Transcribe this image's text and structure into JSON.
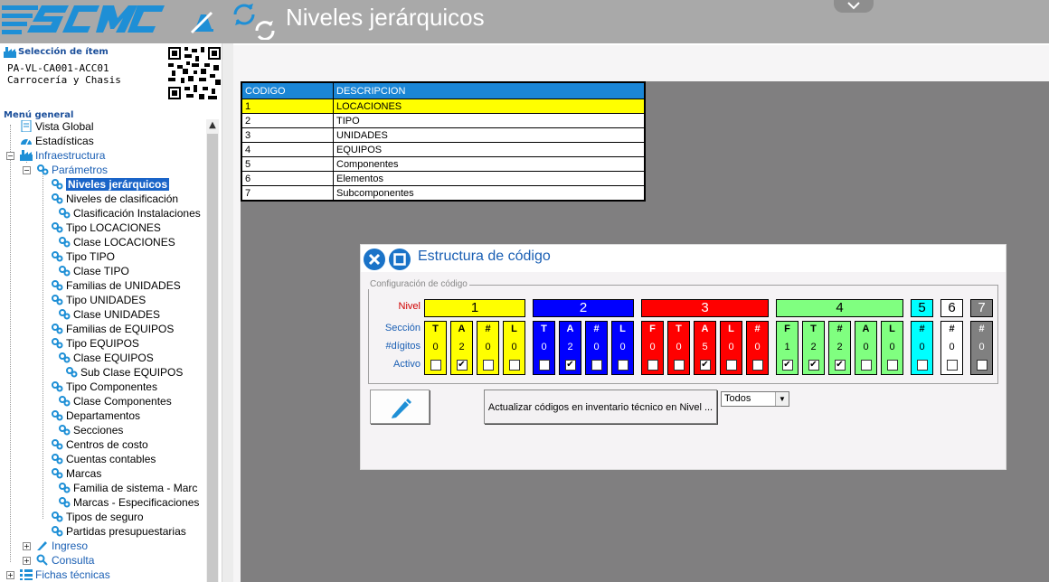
{
  "header": {
    "title": "Niveles jerárquicos"
  },
  "selection": {
    "label": "Selección de ítem",
    "code": "PA-VL-CA001-ACC01",
    "name": "Carrocería y Chasis"
  },
  "menu": {
    "label": "Menú general",
    "items": [
      {
        "label": "Vista Global"
      },
      {
        "label": "Estadísticas"
      },
      {
        "label": "Infraestructura"
      },
      {
        "label": "Parámetros"
      },
      {
        "label": "Niveles jerárquicos"
      },
      {
        "label": "Niveles de clasificación"
      },
      {
        "label": "Clasificación Instalaciones"
      },
      {
        "label": "Tipo LOCACIONES"
      },
      {
        "label": "Clase LOCACIONES"
      },
      {
        "label": "Tipo TIPO"
      },
      {
        "label": "Clase TIPO"
      },
      {
        "label": "Familias de UNIDADES"
      },
      {
        "label": "Tipo UNIDADES"
      },
      {
        "label": "Clase UNIDADES"
      },
      {
        "label": "Familias de EQUIPOS"
      },
      {
        "label": "Tipo EQUIPOS"
      },
      {
        "label": "Clase EQUIPOS"
      },
      {
        "label": "Sub Clase EQUIPOS"
      },
      {
        "label": "Tipo Componentes"
      },
      {
        "label": "Clase Componentes"
      },
      {
        "label": "Departamentos"
      },
      {
        "label": "Secciones"
      },
      {
        "label": "Centros de costo"
      },
      {
        "label": "Cuentas contables"
      },
      {
        "label": "Marcas"
      },
      {
        "label": "Familia de sistema - Marc"
      },
      {
        "label": "Marcas - Especificaciones"
      },
      {
        "label": "Tipos de seguro"
      },
      {
        "label": "Partidas presupuestarias"
      },
      {
        "label": "Ingreso"
      },
      {
        "label": "Consulta"
      },
      {
        "label": "Fichas técnicas"
      }
    ]
  },
  "grid": {
    "headers": [
      "CODIGO",
      "DESCRIPCION"
    ],
    "rows": [
      [
        "1",
        "LOCACIONES"
      ],
      [
        "2",
        "TIPO"
      ],
      [
        "3",
        "UNIDADES"
      ],
      [
        "4",
        "EQUIPOS"
      ],
      [
        "5",
        "Componentes"
      ],
      [
        "6",
        "Elementos"
      ],
      [
        "7",
        "Subcomponentes"
      ]
    ]
  },
  "dialog": {
    "title": "Estructura de código",
    "legend": "Configuración de código",
    "row_labels": {
      "nivel": "Nivel",
      "seccion": "Sección",
      "digitos": "#dígitos",
      "activo": "Activo"
    },
    "levels": [
      {
        "label": "1",
        "color": "#ffff00",
        "text_color": "#000000"
      },
      {
        "label": "2",
        "color": "#0000ff",
        "text_color": "#ffffff"
      },
      {
        "label": "3",
        "color": "#ff0000",
        "text_color": "#ffffff"
      },
      {
        "label": "4",
        "color": "#80ff80",
        "text_color": "#000000"
      },
      {
        "label": "5",
        "color": "#00ffff",
        "text_color": "#000000"
      },
      {
        "label": "6",
        "color": "#ffffff",
        "text_color": "#000000"
      },
      {
        "label": "7",
        "color": "#808080",
        "text_color": "#ffffff"
      }
    ],
    "sections": [
      {
        "level": 1,
        "section": "T",
        "digits": "0",
        "active": false
      },
      {
        "level": 1,
        "section": "A",
        "digits": "2",
        "active": true
      },
      {
        "level": 1,
        "section": "#",
        "digits": "0",
        "active": false
      },
      {
        "level": 1,
        "section": "L",
        "digits": "0",
        "active": false
      },
      {
        "level": 2,
        "section": "T",
        "digits": "0",
        "active": false
      },
      {
        "level": 2,
        "section": "A",
        "digits": "2",
        "active": true
      },
      {
        "level": 2,
        "section": "#",
        "digits": "0",
        "active": false
      },
      {
        "level": 2,
        "section": "L",
        "digits": "0",
        "active": false
      },
      {
        "level": 3,
        "section": "F",
        "digits": "0",
        "active": false
      },
      {
        "level": 3,
        "section": "T",
        "digits": "0",
        "active": false
      },
      {
        "level": 3,
        "section": "A",
        "digits": "5",
        "active": true
      },
      {
        "level": 3,
        "section": "L",
        "digits": "0",
        "active": false
      },
      {
        "level": 3,
        "section": "#",
        "digits": "0",
        "active": false
      },
      {
        "level": 4,
        "section": "F",
        "digits": "1",
        "active": true
      },
      {
        "level": 4,
        "section": "T",
        "digits": "2",
        "active": true
      },
      {
        "level": 4,
        "section": "#",
        "digits": "2",
        "active": true
      },
      {
        "level": 4,
        "section": "A",
        "digits": "0",
        "active": false
      },
      {
        "level": 4,
        "section": "L",
        "digits": "0",
        "active": false
      },
      {
        "level": 5,
        "section": "#",
        "digits": "0",
        "active": false
      },
      {
        "level": 6,
        "section": "#",
        "digits": "0",
        "active": false
      },
      {
        "level": 7,
        "section": "#",
        "digits": "0",
        "active": false
      }
    ],
    "update_button": "Actualizar códigos en inventario técnico en Nivel ...",
    "filter": {
      "selected": "Todos"
    }
  }
}
